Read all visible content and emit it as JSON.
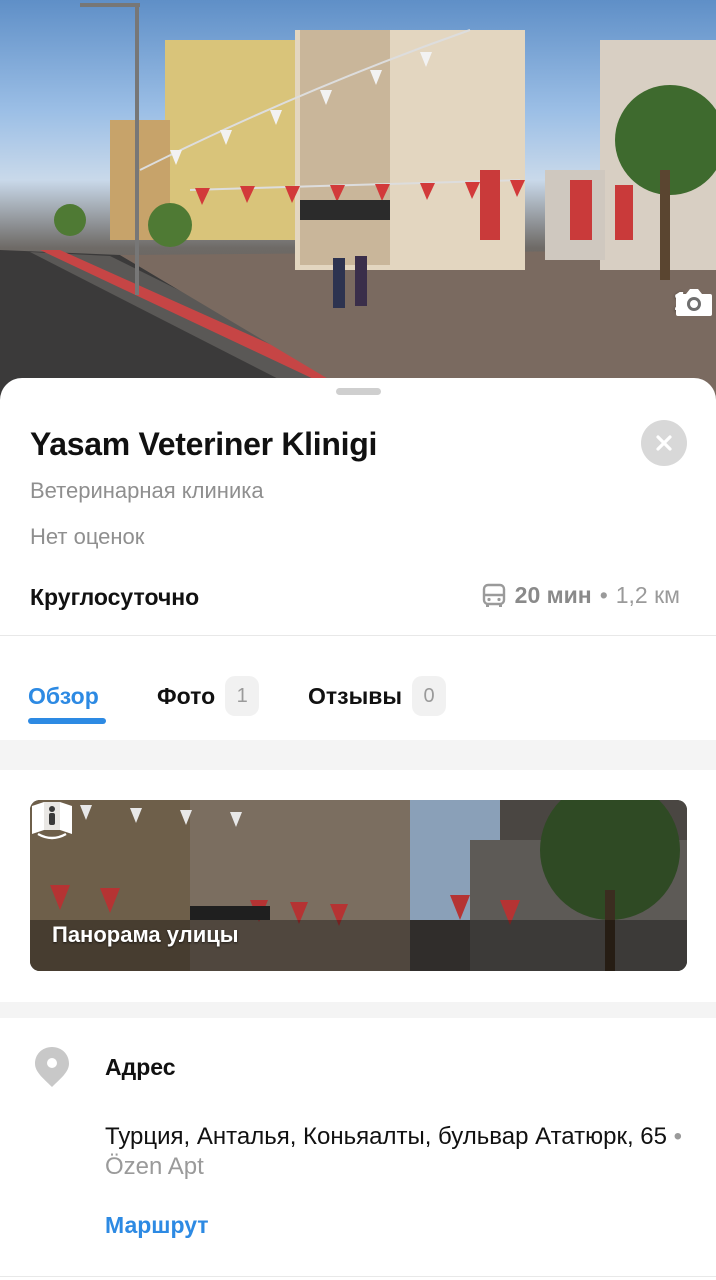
{
  "hero": {
    "photo_icon": "camera-icon",
    "photo_count": "1"
  },
  "place": {
    "name": "Yasam Veteriner Klinigi",
    "category": "Ветеринарная клиника",
    "rating_text": "Нет оценок",
    "hours": "Круглосуточно",
    "transit": {
      "icon": "bus-icon",
      "time": "20 мин",
      "separator": "•",
      "distance": "1,2 км"
    }
  },
  "tabs": [
    {
      "label": "Обзор",
      "count": null,
      "active": true
    },
    {
      "label": "Фото",
      "count": "1",
      "active": false
    },
    {
      "label": "Отзывы",
      "count": "0",
      "active": false
    }
  ],
  "panorama": {
    "icon": "street-panorama-icon",
    "label": "Панорама улицы"
  },
  "address": {
    "icon": "map-pin-icon",
    "heading": "Адрес",
    "line": "Турция, Анталья, Коньяалты, бульвар Ататюрк, 65",
    "separator": "•",
    "building": "Özen Apt",
    "route_label": "Маршрут"
  },
  "colors": {
    "accent": "#2d8ae3",
    "muted_text": "#8f8f8f",
    "close_button_bg": "#d8d8d8"
  }
}
